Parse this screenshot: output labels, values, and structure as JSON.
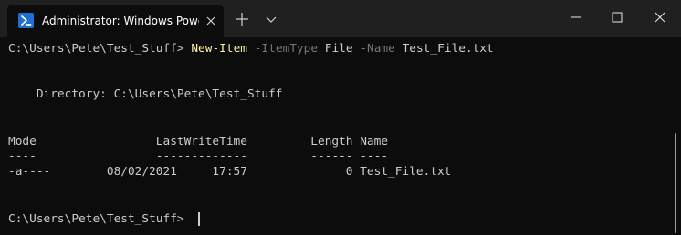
{
  "tab": {
    "title": "Administrator: Windows PowerShell",
    "icon": "powershell-icon"
  },
  "titlebar": {
    "new_tab_icon": "plus-icon",
    "dropdown_icon": "chevron-down-icon",
    "minimize_icon": "minimize-icon",
    "maximize_icon": "maximize-icon",
    "close_icon": "close-icon"
  },
  "colors": {
    "background": "#0c0c0c",
    "titlebar": "#202020",
    "text": "#cccccc",
    "command": "#f9f1a5",
    "parameter": "#767676"
  },
  "terminal": {
    "command_line": {
      "prompt": "C:\\Users\\Pete\\Test_Stuff>",
      "command": "New-Item",
      "param1": "-ItemType",
      "value1": "File",
      "param2": "-Name",
      "value2": "Test_File.txt"
    },
    "directory_line": "    Directory: C:\\Users\\Pete\\Test_Stuff",
    "header_line": "Mode                 LastWriteTime         Length Name",
    "separator_line": "----                 -------------         ------ ----",
    "rows": [
      {
        "text": "-a----        08/02/2021     17:57              0 Test_File.txt"
      }
    ],
    "final_prompt": "C:\\Users\\Pete\\Test_Stuff>"
  }
}
